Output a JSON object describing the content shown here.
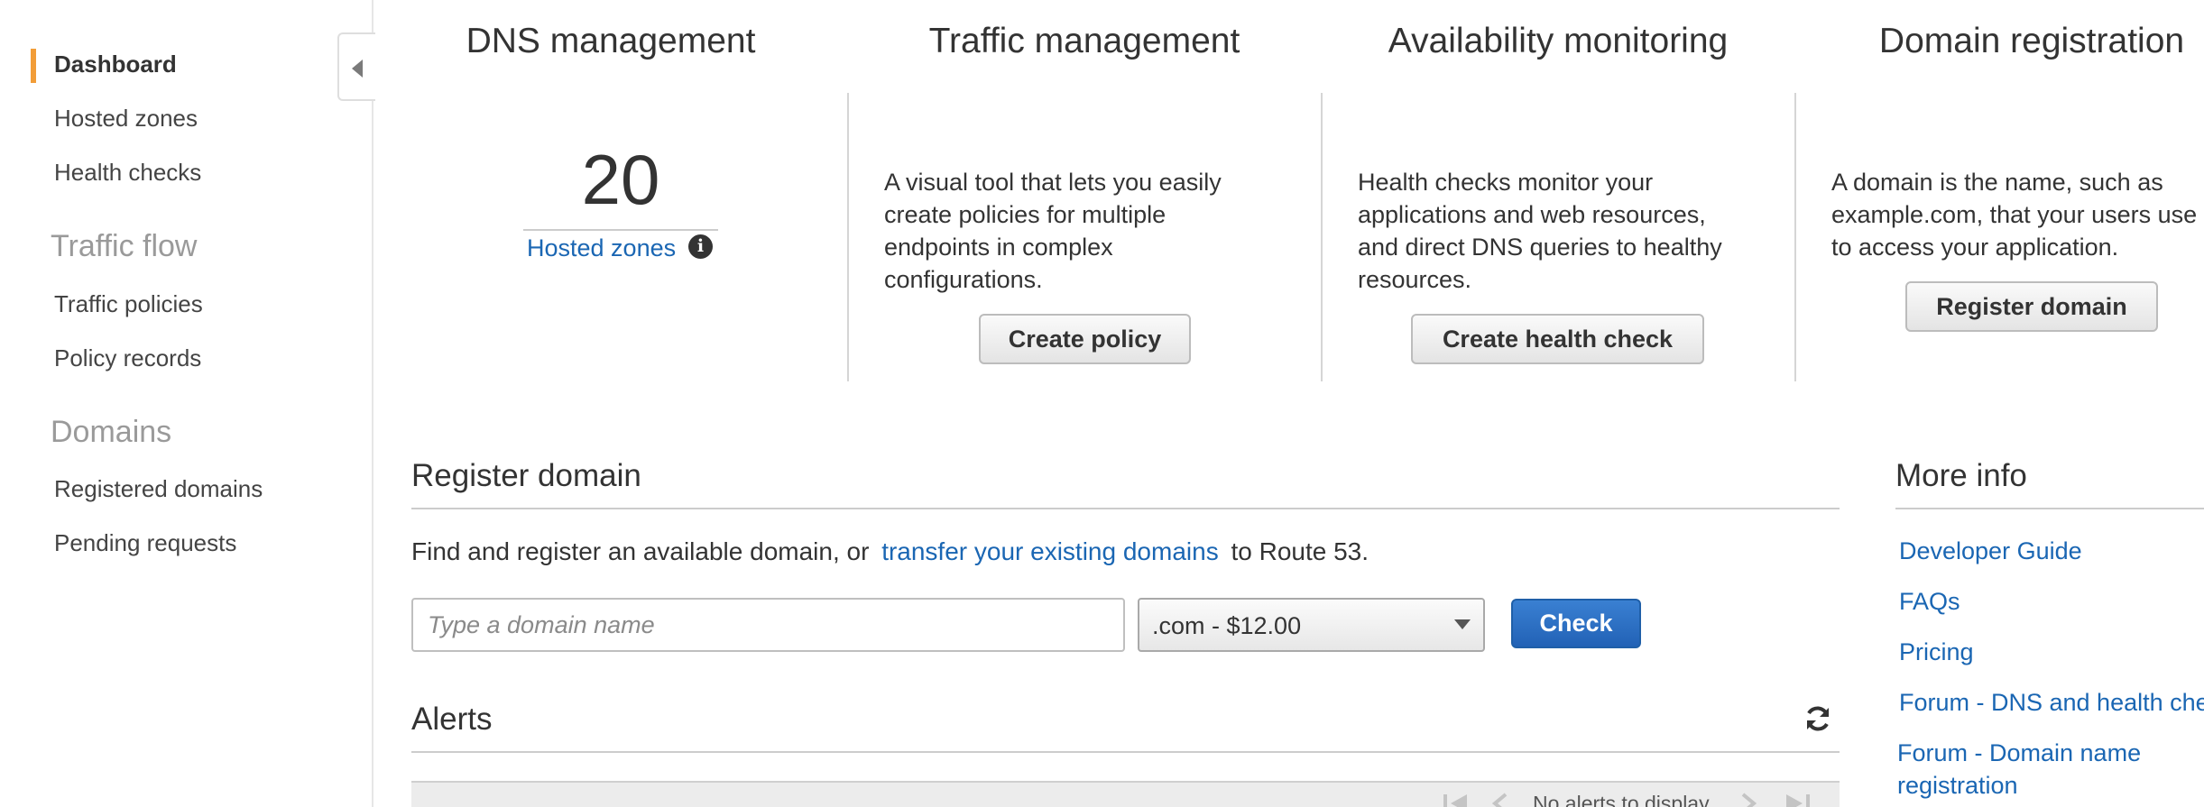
{
  "sidebar": {
    "items": [
      {
        "label": "Dashboard",
        "active": true
      },
      {
        "label": "Hosted zones"
      },
      {
        "label": "Health checks"
      }
    ],
    "sections": [
      {
        "title": "Traffic flow",
        "items": [
          {
            "label": "Traffic policies"
          },
          {
            "label": "Policy records"
          }
        ]
      },
      {
        "title": "Domains",
        "items": [
          {
            "label": "Registered domains"
          },
          {
            "label": "Pending requests"
          }
        ]
      }
    ]
  },
  "cards": {
    "dns": {
      "title": "DNS management",
      "count": "20",
      "link": "Hosted zones"
    },
    "traffic": {
      "title": "Traffic management",
      "description": "A visual tool that lets you easily create policies for multiple endpoints in complex configurations.",
      "button": "Create policy"
    },
    "availability": {
      "title": "Availability monitoring",
      "description": "Health checks monitor your applications and web resources, and direct DNS queries to healthy resources.",
      "button": "Create health check"
    },
    "domain": {
      "title": "Domain registration",
      "description": "A domain is the name, such as example.com, that your users use to access your application.",
      "button": "Register domain"
    }
  },
  "register": {
    "title": "Register domain",
    "text_before": "Find and register an available domain, or",
    "link": "transfer your existing domains",
    "text_after": "to Route 53.",
    "input_placeholder": "Type a domain name",
    "tld_selected": ".com - $12.00",
    "check_button": "Check"
  },
  "alerts": {
    "title": "Alerts",
    "empty_text": "No alerts to display"
  },
  "more_info": {
    "title": "More info",
    "links": [
      "Developer Guide",
      "FAQs",
      "Pricing",
      "Forum - DNS and health checks",
      "Forum - Domain name registration"
    ]
  },
  "colors": {
    "accent": "#f29d38",
    "link": "#1a66b3",
    "primary_button": "#2a6ec4"
  }
}
